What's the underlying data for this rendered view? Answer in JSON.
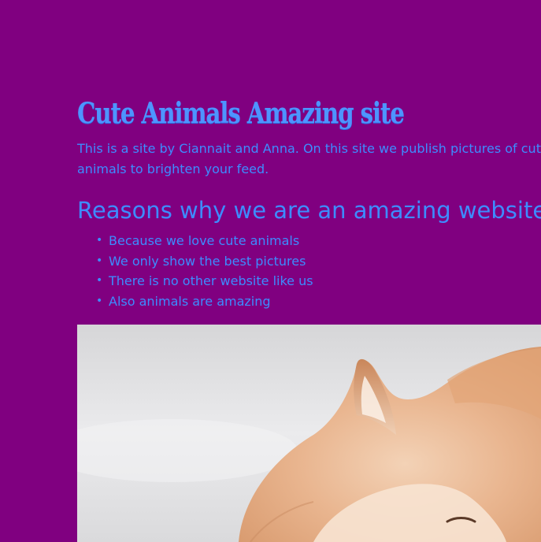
{
  "page": {
    "title": "Cute Animals Amazing site",
    "intro": "This is a site by Ciannait and Anna. On this site we publish pictures of cute animals to brighten your feed.",
    "reasons_heading": "Reasons why we are an amazing website!",
    "reasons": [
      "Because we love cute animals",
      "We only show the best pictures",
      "There is no other website like us",
      "Also animals are amazing"
    ],
    "bullet": "•",
    "image": {
      "subject": "red fox resting on snow",
      "icon": "fox-photo"
    }
  },
  "colors": {
    "background": "#800080",
    "text": "#3d8cff",
    "title": "#4e94ff"
  }
}
